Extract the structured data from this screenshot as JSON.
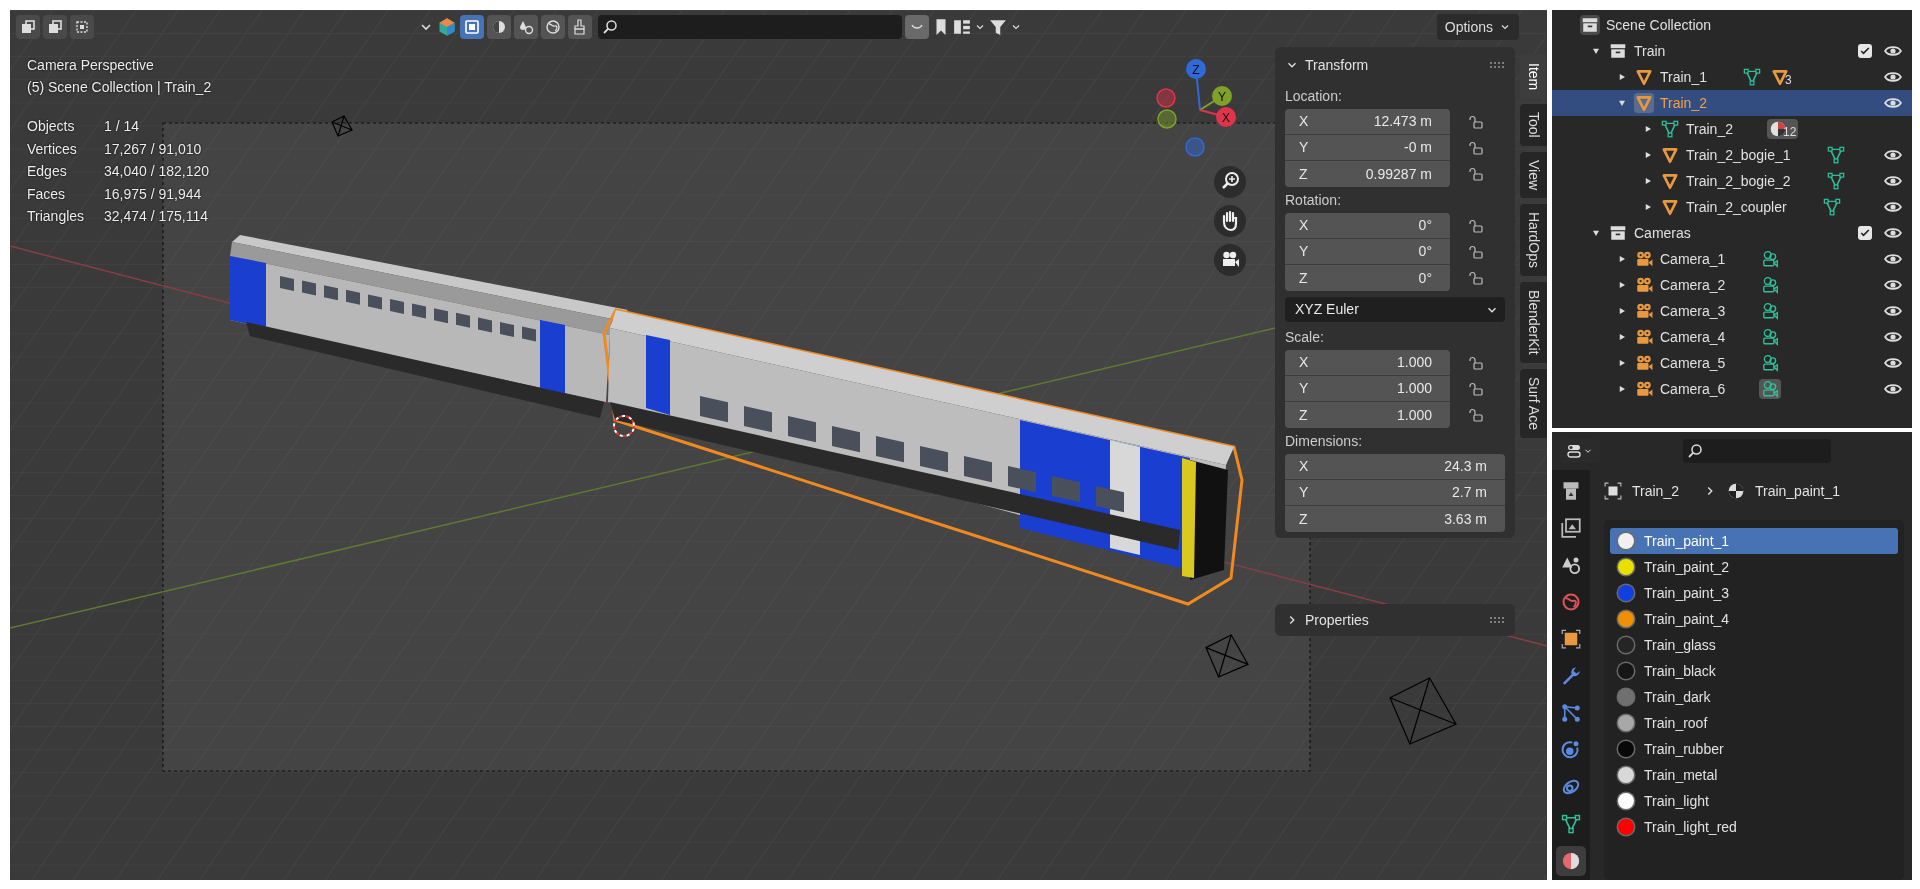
{
  "viewport": {
    "header": {
      "toggles": [
        {
          "kind": "select-box",
          "selected": true
        },
        {
          "kind": "shading",
          "selected": false
        },
        {
          "kind": "droplets",
          "selected": false
        },
        {
          "kind": "globe",
          "selected": false
        },
        {
          "kind": "brush",
          "selected": false
        }
      ],
      "options": "Options"
    },
    "title": "Camera Perspective",
    "subtitle": "(5) Scene Collection | Train_2",
    "stats": [
      {
        "label": "Objects",
        "value": "1 / 14"
      },
      {
        "label": "Vertices",
        "value": "17,267 / 91,010"
      },
      {
        "label": "Edges",
        "value": "34,040 / 182,120"
      },
      {
        "label": "Faces",
        "value": "16,975 / 91,944"
      },
      {
        "label": "Triangles",
        "value": "32,474 / 175,114"
      }
    ],
    "gizmo": {
      "axes": [
        {
          "label": "Z",
          "color": "#2f6ad8"
        },
        {
          "label": "Y",
          "color": "#7fa12a"
        },
        {
          "label": "X",
          "color": "#e0344a"
        }
      ]
    }
  },
  "sidebar": {
    "tabs": [
      {
        "label": "Item",
        "selected": true
      },
      {
        "label": "Tool",
        "selected": false
      },
      {
        "label": "View",
        "selected": false
      },
      {
        "label": "HardOps",
        "selected": false
      },
      {
        "label": "BlenderKit",
        "selected": false
      },
      {
        "label": "Surf Ace",
        "selected": false
      }
    ],
    "transform": {
      "title": "Transform",
      "expanded": true,
      "groups": [
        {
          "kind": "vector",
          "label": "Location:",
          "fields": [
            {
              "axis": "X",
              "value": "12.473 m",
              "locked": false
            },
            {
              "axis": "Y",
              "value": "-0 m",
              "locked": false
            },
            {
              "axis": "Z",
              "value": "0.99287 m",
              "locked": false
            }
          ]
        },
        {
          "kind": "vector",
          "label": "Rotation:",
          "fields": [
            {
              "axis": "X",
              "value": "0°",
              "locked": false
            },
            {
              "axis": "Y",
              "value": "0°",
              "locked": false
            },
            {
              "axis": "Z",
              "value": "0°",
              "locked": false
            }
          ]
        },
        {
          "kind": "dropdown",
          "value": "XYZ Euler"
        },
        {
          "kind": "vector",
          "label": "Scale:",
          "fields": [
            {
              "axis": "X",
              "value": "1.000",
              "locked": false
            },
            {
              "axis": "Y",
              "value": "1.000",
              "locked": false
            },
            {
              "axis": "Z",
              "value": "1.000",
              "locked": false
            }
          ]
        },
        {
          "kind": "vector",
          "label": "Dimensions:",
          "fields": [
            {
              "axis": "X",
              "value": "24.3 m"
            },
            {
              "axis": "Y",
              "value": "2.7 m"
            },
            {
              "axis": "Z",
              "value": "3.63 m"
            }
          ]
        }
      ]
    },
    "properties": {
      "title": "Properties",
      "expanded": false
    }
  },
  "outliner": {
    "root": "Scene Collection",
    "items": [
      {
        "name": "Train",
        "kind": "collection",
        "expanded": true,
        "selected": false,
        "checked": true,
        "visible": true,
        "children": [
          {
            "name": "Train_1",
            "kind": "object",
            "expanded": false,
            "selected": false,
            "visible": true,
            "badges": [
              {
                "kind": "mesh",
                "active": false
              },
              {
                "kind": "object",
                "count": "3",
                "active": false
              }
            ]
          },
          {
            "name": "Train_2",
            "kind": "object",
            "expanded": true,
            "selected": true,
            "visible": true,
            "children": [
              {
                "name": "Train_2",
                "kind": "mesh",
                "expanded": false,
                "selected": false,
                "badges": [
                  {
                    "kind": "material",
                    "count": "12",
                    "active": true
                  }
                ]
              },
              {
                "name": "Train_2_bogie_1",
                "kind": "object",
                "expanded": false,
                "selected": false,
                "visible": true,
                "badges": [
                  {
                    "kind": "mesh",
                    "active": false
                  }
                ]
              },
              {
                "name": "Train_2_bogie_2",
                "kind": "object",
                "expanded": false,
                "selected": false,
                "visible": true,
                "badges": [
                  {
                    "kind": "mesh",
                    "active": false
                  }
                ]
              },
              {
                "name": "Train_2_coupler",
                "kind": "object",
                "expanded": false,
                "selected": false,
                "visible": true,
                "badges": [
                  {
                    "kind": "mesh",
                    "active": false
                  }
                ]
              }
            ]
          }
        ]
      },
      {
        "name": "Cameras",
        "kind": "collection",
        "expanded": true,
        "selected": false,
        "checked": true,
        "visible": true,
        "children": [
          {
            "name": "Camera_1",
            "kind": "camera",
            "expanded": false,
            "selected": false,
            "visible": true,
            "badges": [
              {
                "kind": "camera",
                "active": false
              }
            ]
          },
          {
            "name": "Camera_2",
            "kind": "camera",
            "expanded": false,
            "selected": false,
            "visible": true,
            "badges": [
              {
                "kind": "camera",
                "active": false
              }
            ]
          },
          {
            "name": "Camera_3",
            "kind": "camera",
            "expanded": false,
            "selected": false,
            "visible": true,
            "badges": [
              {
                "kind": "camera",
                "active": false
              }
            ]
          },
          {
            "name": "Camera_4",
            "kind": "camera",
            "expanded": false,
            "selected": false,
            "visible": true,
            "badges": [
              {
                "kind": "camera",
                "active": false
              }
            ]
          },
          {
            "name": "Camera_5",
            "kind": "camera",
            "expanded": false,
            "selected": false,
            "visible": true,
            "badges": [
              {
                "kind": "camera",
                "active": false
              }
            ]
          },
          {
            "name": "Camera_6",
            "kind": "camera",
            "expanded": false,
            "selected": false,
            "visible": true,
            "badges": [
              {
                "kind": "camera",
                "active": true
              }
            ]
          }
        ]
      }
    ]
  },
  "properties": {
    "tabs": [
      {
        "kind": "output",
        "selected": false
      },
      {
        "kind": "view-layer",
        "selected": false
      },
      {
        "kind": "scene",
        "selected": false
      },
      {
        "kind": "world",
        "selected": false
      },
      {
        "kind": "object",
        "selected": false
      },
      {
        "kind": "modifiers",
        "selected": false
      },
      {
        "kind": "particles",
        "selected": false
      },
      {
        "kind": "physics",
        "selected": false
      },
      {
        "kind": "constraints",
        "selected": false
      },
      {
        "kind": "data",
        "selected": false
      },
      {
        "kind": "material",
        "selected": true
      }
    ],
    "breadcrumb": [
      "Train_2",
      "Train_paint_1"
    ],
    "materials": [
      {
        "name": "Train_paint_1",
        "color": "#f0f0f0",
        "selected": true
      },
      {
        "name": "Train_paint_2",
        "color": "#e8e000",
        "selected": false
      },
      {
        "name": "Train_paint_3",
        "color": "#1240e0",
        "selected": false
      },
      {
        "name": "Train_paint_4",
        "color": "#f09000",
        "selected": false
      },
      {
        "name": "Train_glass",
        "color": "#252525",
        "selected": false
      },
      {
        "name": "Train_black",
        "color": "#161616",
        "selected": false
      },
      {
        "name": "Train_dark",
        "color": "#707070",
        "selected": false
      },
      {
        "name": "Train_roof",
        "color": "#a8a8a8",
        "selected": false
      },
      {
        "name": "Train_rubber",
        "color": "#080808",
        "selected": false
      },
      {
        "name": "Train_metal",
        "color": "#d8d8d8",
        "selected": false
      },
      {
        "name": "Train_light",
        "color": "#ffffff",
        "selected": false
      },
      {
        "name": "Train_light_red",
        "color": "#ff0000",
        "selected": false
      }
    ]
  }
}
